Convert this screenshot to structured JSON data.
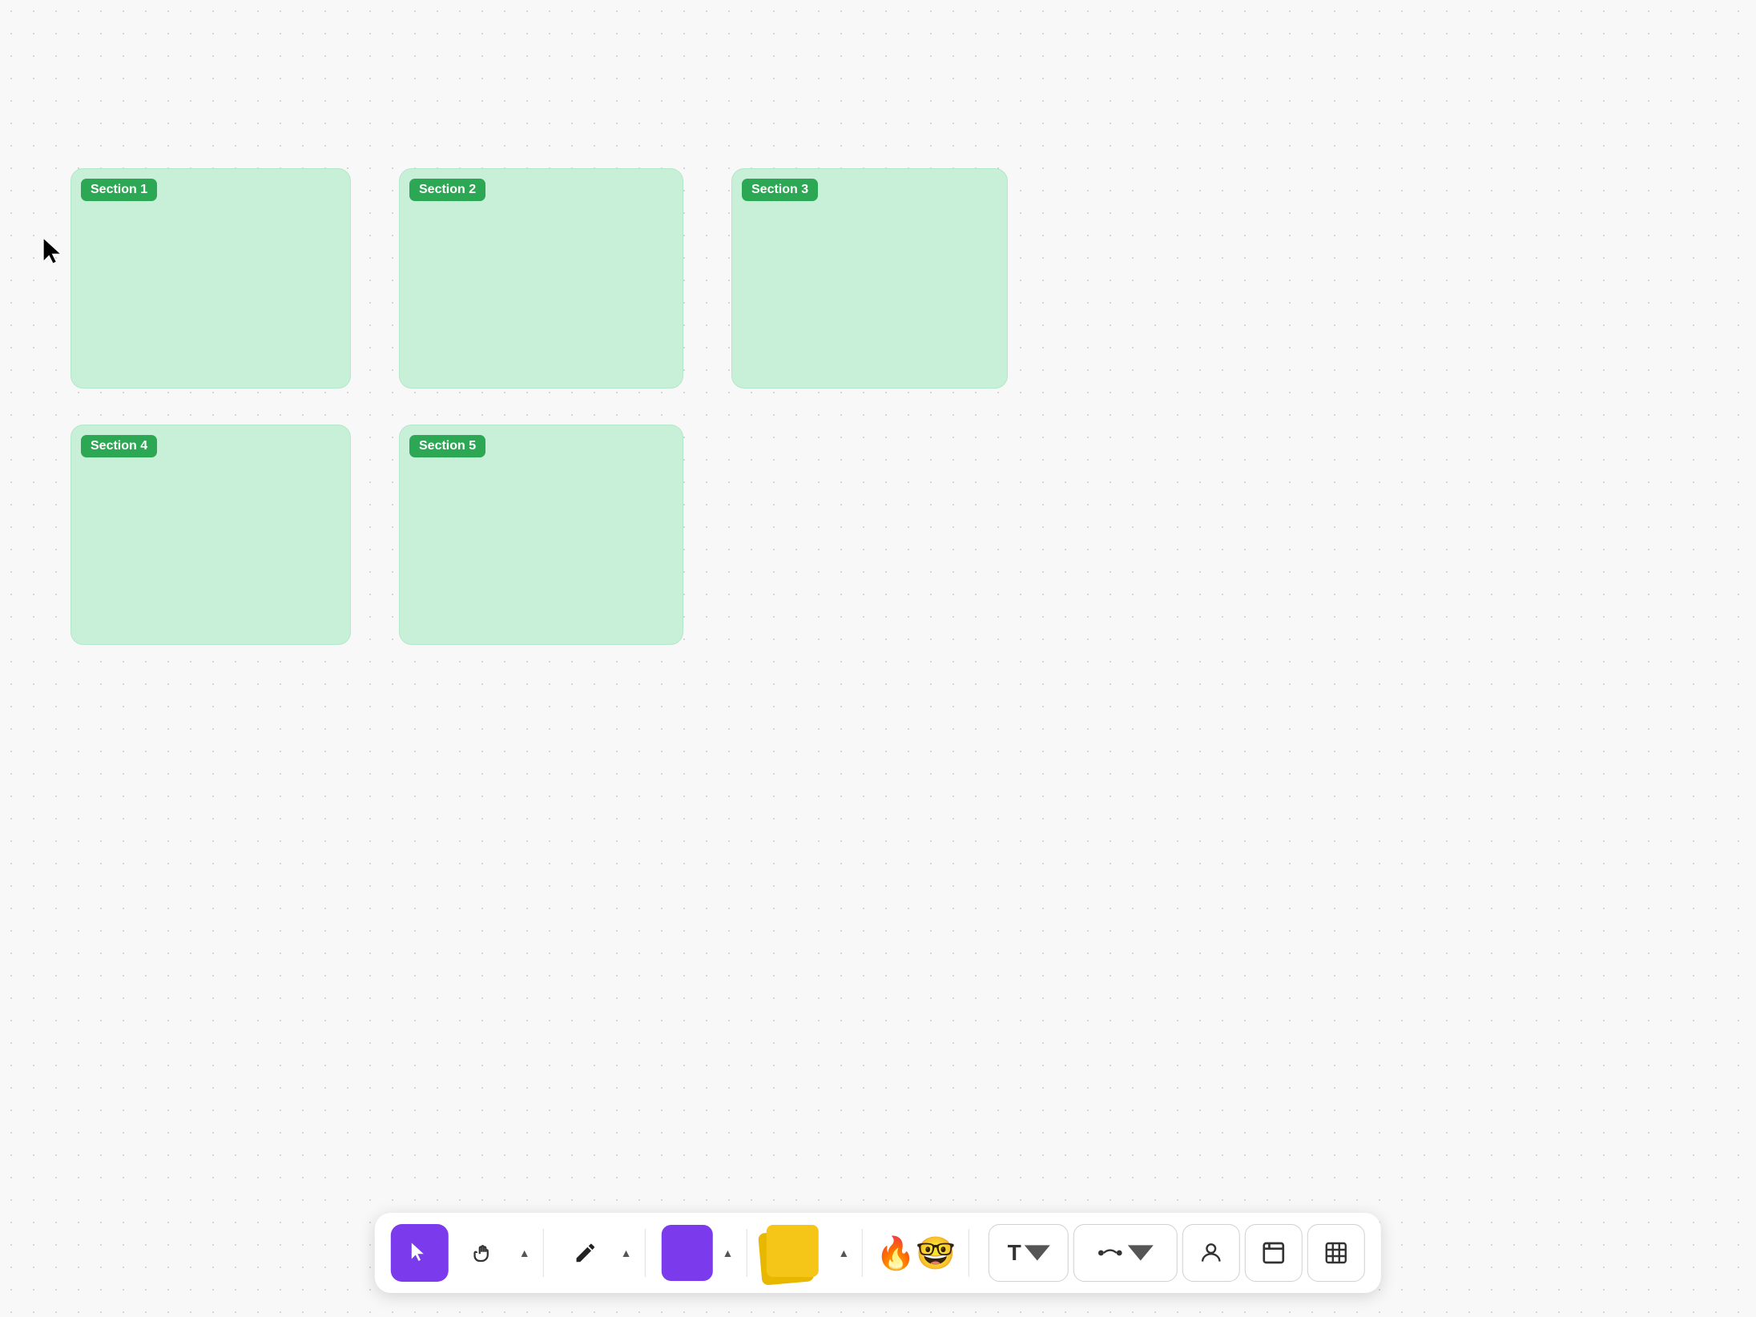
{
  "canvas": {
    "background": "#f8f8f8"
  },
  "sections": [
    {
      "id": "s1",
      "label": "Section 1",
      "row": 1,
      "col": 1
    },
    {
      "id": "s2",
      "label": "Section 2",
      "row": 1,
      "col": 2
    },
    {
      "id": "s3",
      "label": "Section 3",
      "row": 1,
      "col": 3
    },
    {
      "id": "s4",
      "label": "Section 4",
      "row": 2,
      "col": 1
    },
    {
      "id": "s5",
      "label": "Section 5",
      "row": 2,
      "col": 2
    }
  ],
  "toolbar": {
    "tools": [
      {
        "id": "select",
        "label": "Select",
        "active": true
      },
      {
        "id": "hand",
        "label": "Hand"
      },
      {
        "id": "pen",
        "label": "Pen"
      },
      {
        "id": "purple-block",
        "label": "Shape"
      },
      {
        "id": "sticky-notes",
        "label": "Sticky Notes"
      },
      {
        "id": "emoji",
        "label": "Emoji"
      },
      {
        "id": "text",
        "label": "Text"
      },
      {
        "id": "connector",
        "label": "Connector"
      },
      {
        "id": "person",
        "label": "Person"
      },
      {
        "id": "frame",
        "label": "Frame"
      },
      {
        "id": "table",
        "label": "Table"
      }
    ],
    "text_tool_label": "T",
    "connector_tool_label": "→"
  }
}
